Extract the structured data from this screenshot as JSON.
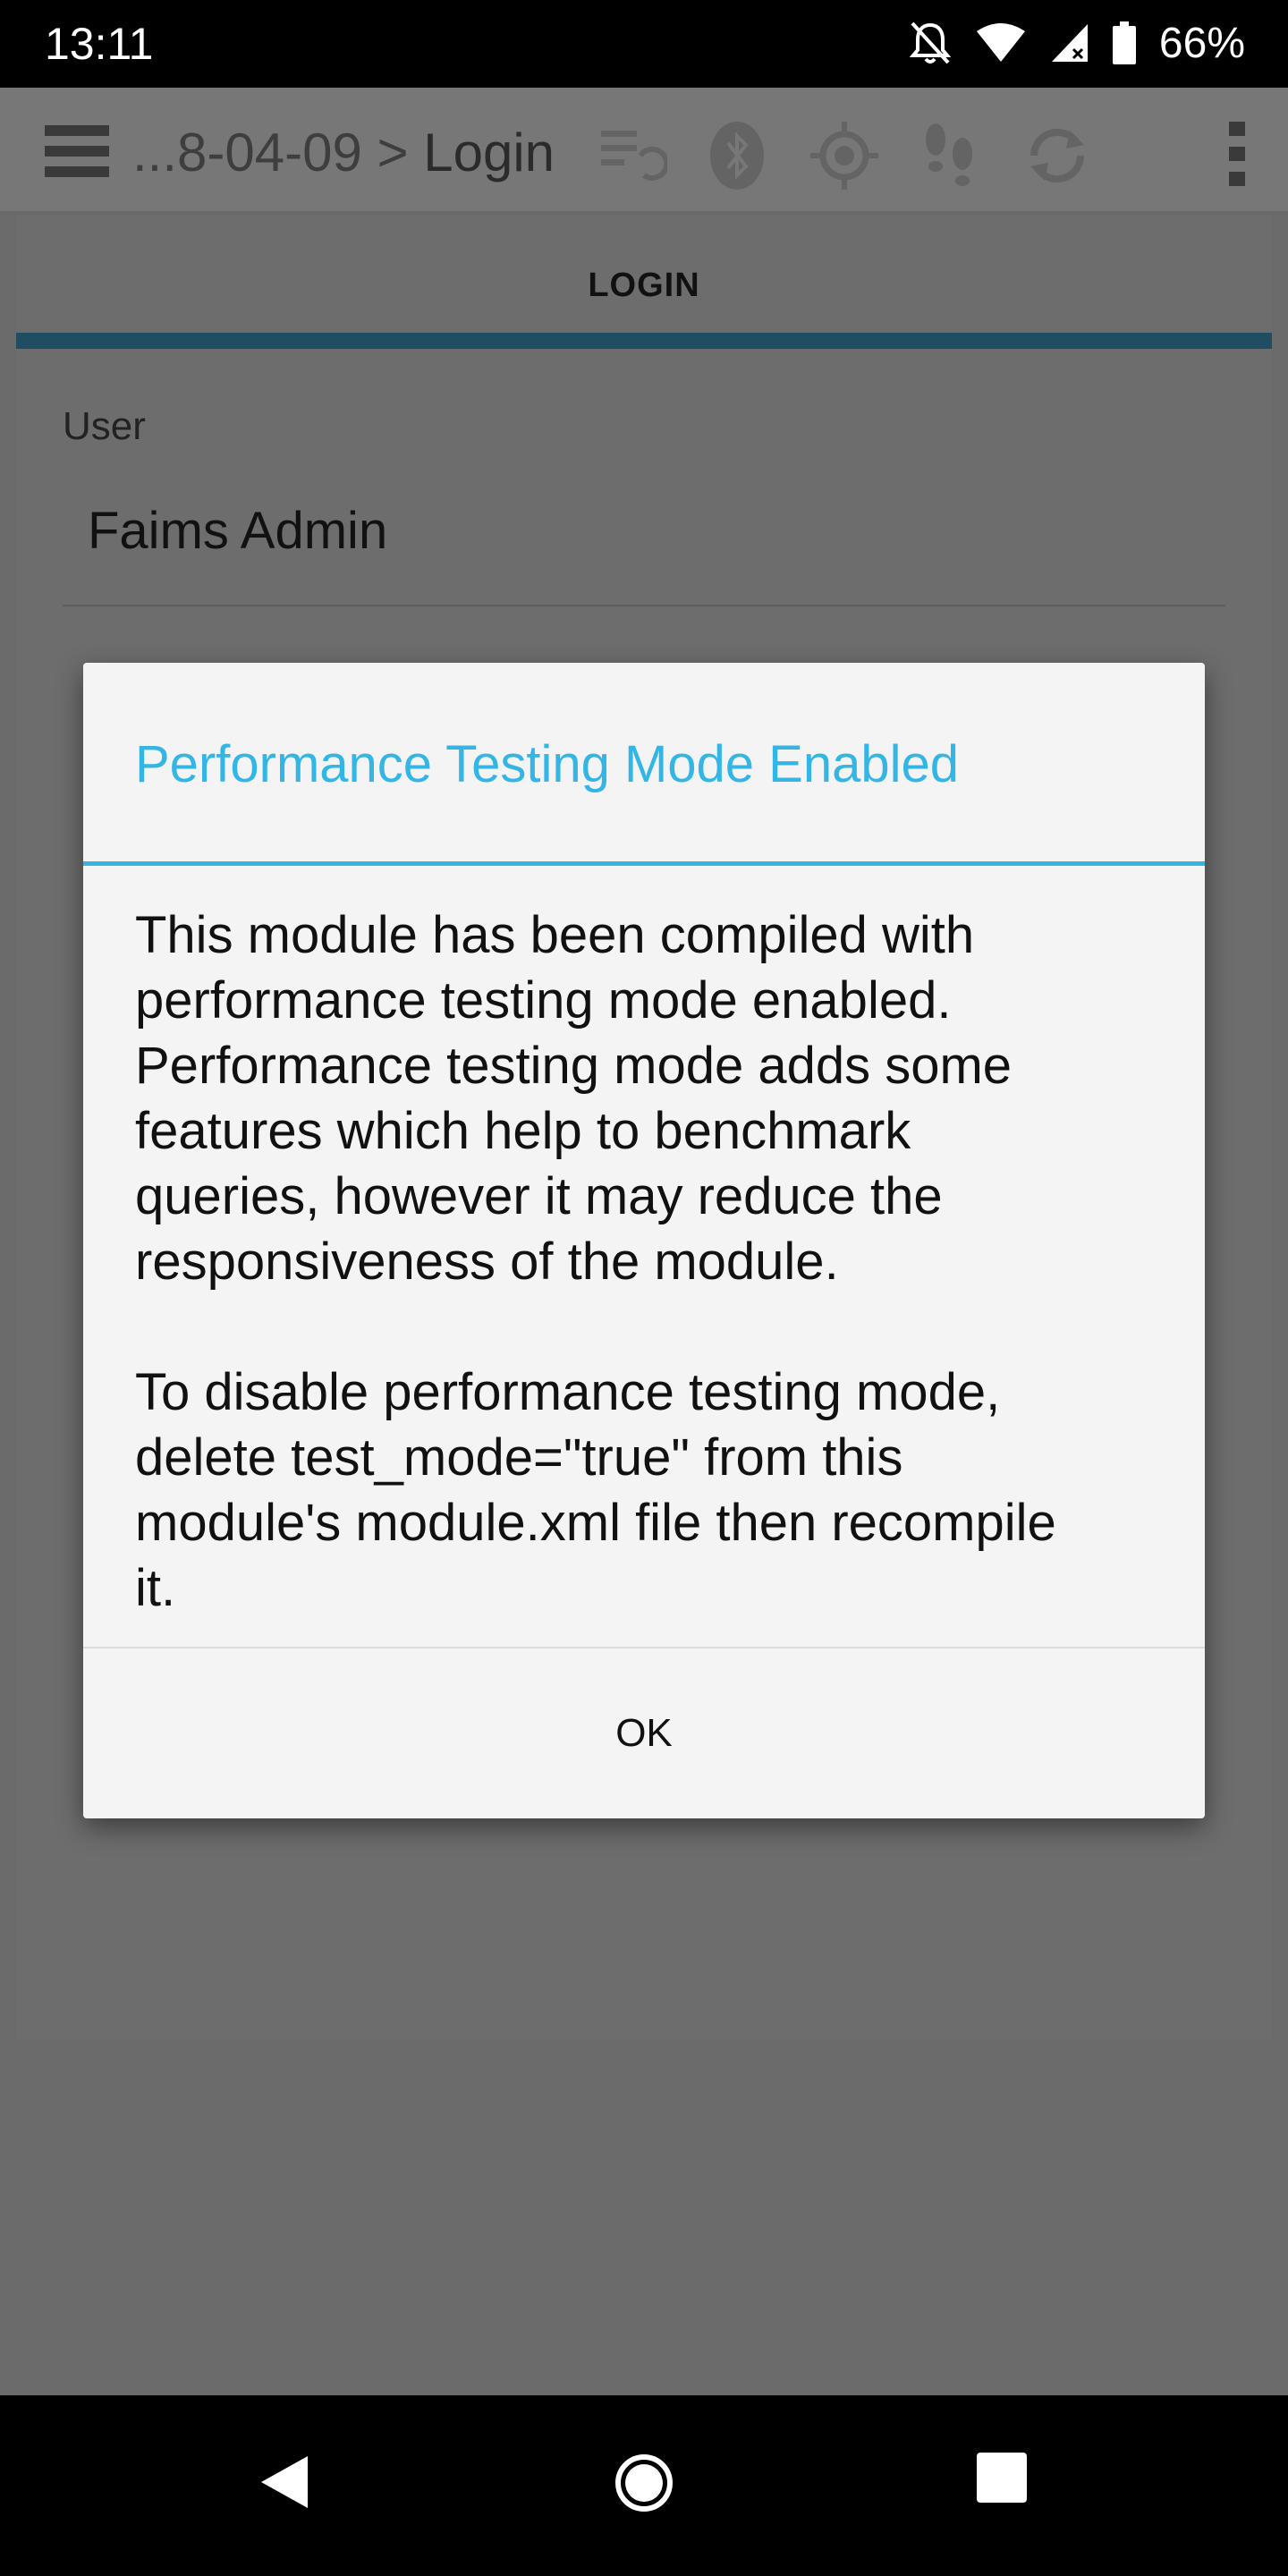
{
  "status_bar": {
    "time": "13:11",
    "battery": "66%",
    "icons": [
      "mute-icon",
      "wifi-icon",
      "signal-icon",
      "battery-icon"
    ]
  },
  "toolbar": {
    "breadcrumb_prefix": "...8-04-09",
    "breadcrumb_separator": ">",
    "breadcrumb_current": "Login",
    "icons": [
      "menu-icon",
      "sync-list-icon",
      "bluetooth-icon",
      "gps-icon",
      "tracking-icon",
      "sync-icon",
      "overflow-menu-icon"
    ]
  },
  "tab": {
    "label": "LOGIN"
  },
  "form": {
    "user_label": "User",
    "user_value": "Faims Admin"
  },
  "dialog": {
    "title": "Performance Testing Mode Enabled",
    "message": "This module has been compiled with\nperformance testing mode enabled.\nPerformance testing mode adds some\nfeatures which help to benchmark\nqueries, however it may reduce the\nresponsiveness of the module.\n\nTo disable performance testing mode,\ndelete test_mode=\"true\" from this\nmodule's module.xml file then recompile\nit.",
    "ok_label": "OK"
  },
  "colors": {
    "accent": "#33b5e5",
    "tab_indicator": "#1f4e63",
    "scrim_background": "#6b6b6b"
  },
  "nav_bar": {
    "icons": [
      "back-icon",
      "home-icon",
      "recents-icon"
    ]
  }
}
